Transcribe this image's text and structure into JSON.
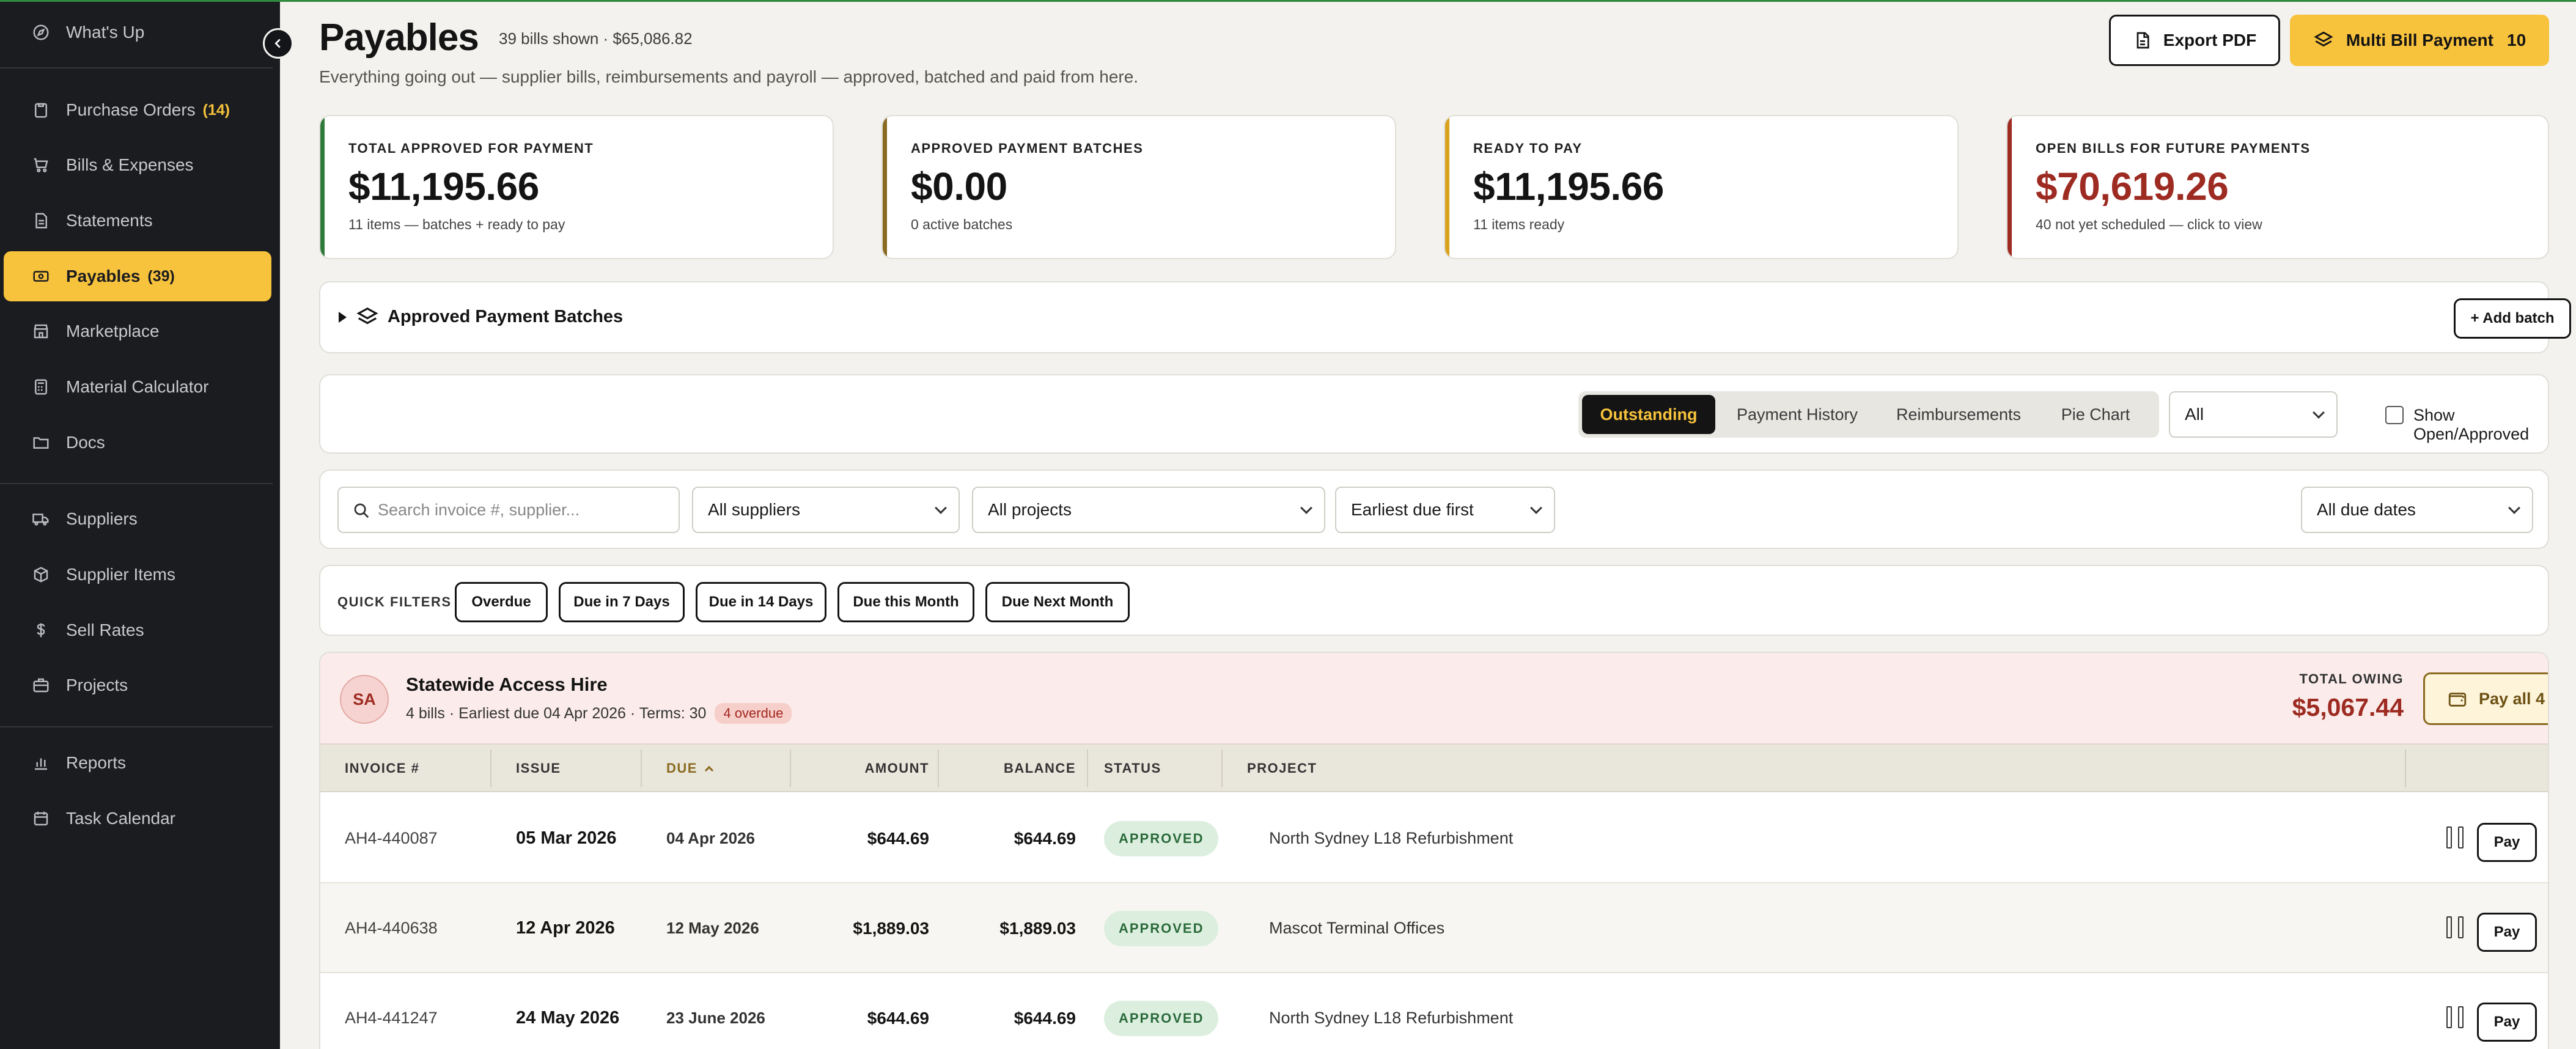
{
  "sidebar": {
    "items": [
      {
        "label": "What's Up",
        "icon": "compass-icon"
      },
      {
        "label": "Purchase Orders",
        "count": "(14)",
        "icon": "clipboard-icon"
      },
      {
        "label": "Bills & Expenses",
        "icon": "cart-icon"
      },
      {
        "label": "Statements",
        "icon": "document-icon"
      },
      {
        "label": "Payables",
        "count": "(39)",
        "icon": "banknote-icon"
      },
      {
        "label": "Marketplace",
        "icon": "store-icon"
      },
      {
        "label": "Material Calculator",
        "icon": "calculator-icon"
      },
      {
        "label": "Docs",
        "icon": "folder-icon"
      },
      {
        "label": "Suppliers",
        "icon": "truck-icon"
      },
      {
        "label": "Supplier Items",
        "icon": "box-icon"
      },
      {
        "label": "Sell Rates",
        "icon": "dollar-icon"
      },
      {
        "label": "Projects",
        "icon": "briefcase-icon"
      },
      {
        "label": "Reports",
        "icon": "bar-chart-icon"
      },
      {
        "label": "Task Calendar",
        "icon": "calendar-icon"
      }
    ]
  },
  "header": {
    "title": "Payables",
    "meta": "39 bills shown · $65,086.82",
    "subtitle": "Everything going out — supplier bills, reimbursements and payroll — approved, batched and paid from here.",
    "export_label": "Export PDF",
    "multi_label": "Multi Bill Payment",
    "multi_count": "10"
  },
  "kpis": [
    {
      "label": "TOTAL APPROVED FOR PAYMENT",
      "value": "$11,195.66",
      "note": "11 items — batches + ready to pay",
      "accent": "#2f7a3a",
      "value_color": "#141414"
    },
    {
      "label": "APPROVED PAYMENT BATCHES",
      "value": "$0.00",
      "note": "0 active batches",
      "accent": "#8a6a1f",
      "value_color": "#141414"
    },
    {
      "label": "READY TO PAY",
      "value": "$11,195.66",
      "note": "11 items ready",
      "accent": "#d8a21e",
      "value_color": "#141414"
    },
    {
      "label": "OPEN BILLS FOR FUTURE PAYMENTS",
      "value": "$70,619.26",
      "note": "40 not yet scheduled — click to view",
      "accent": "#9d2b22",
      "value_color": "#9d2b22"
    }
  ],
  "batches": {
    "title": "Approved Payment Batches",
    "add_label": "+ Add batch"
  },
  "tabs": {
    "items": [
      "Outstanding",
      "Payment History",
      "Reimbursements",
      "Pie Chart"
    ],
    "active": "Outstanding",
    "type_filter": "All",
    "show_open_label": "Show Open/Approved"
  },
  "filters": {
    "search_placeholder": "Search invoice #, supplier...",
    "supplier": "All suppliers",
    "project": "All projects",
    "sort": "Earliest due first",
    "due_dates": "All due dates"
  },
  "quick_filters": {
    "label": "QUICK FILTERS",
    "chips": [
      "Overdue",
      "Due in 7 Days",
      "Due in 14 Days",
      "Due this Month",
      "Due Next Month"
    ]
  },
  "supplier_group": {
    "initials": "SA",
    "name": "Statewide Access Hire",
    "meta": "4 bills · Earliest due 04 Apr 2026 · Terms: 30",
    "overdue": "4 overdue",
    "owing_label": "TOTAL OWING",
    "owing_value": "$5,067.44",
    "pay_all_label": "Pay all 4"
  },
  "table": {
    "columns": [
      "INVOICE #",
      "ISSUE",
      "DUE",
      "AMOUNT",
      "BALANCE",
      "STATUS",
      "PROJECT"
    ],
    "rows": [
      {
        "invoice": "AH4-440087",
        "issue": "05 Mar 2026",
        "due": "04 Apr 2026",
        "amount": "$644.69",
        "balance": "$644.69",
        "status": "APPROVED",
        "project": "North Sydney L18 Refurbishment",
        "pay": "Pay"
      },
      {
        "invoice": "AH4-440638",
        "issue": "12 Apr 2026",
        "due": "12 May 2026",
        "amount": "$1,889.03",
        "balance": "$1,889.03",
        "status": "APPROVED",
        "project": "Mascot Terminal Offices",
        "pay": "Pay"
      },
      {
        "invoice": "AH4-441247",
        "issue": "24 May 2026",
        "due": "23 June 2026",
        "amount": "$644.69",
        "balance": "$644.69",
        "status": "APPROVED",
        "project": "North Sydney L18 Refurbishment",
        "pay": "Pay"
      }
    ]
  }
}
